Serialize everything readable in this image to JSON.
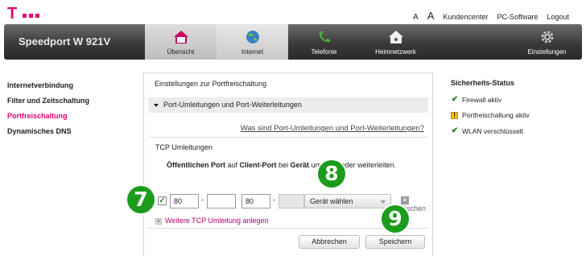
{
  "logo": {
    "letter": "T"
  },
  "toplinks": {
    "a_small": "A",
    "a_big": "A",
    "kundencenter": "Kundencenter",
    "pc_software": "PC-Software",
    "logout": "Logout"
  },
  "navbar": {
    "brand": "Speedport W 921V",
    "tabs": [
      {
        "label": "Übersicht",
        "icon": "house-icon"
      },
      {
        "label": "Internet",
        "icon": "globe-icon"
      },
      {
        "label": "Telefonie",
        "icon": "phone-icon"
      },
      {
        "label": "Heimnetzwerk",
        "icon": "home-network-icon"
      },
      {
        "label": "Einstellungen",
        "icon": "gear-icon"
      }
    ]
  },
  "sidebar": {
    "items": [
      "Internetverbindung",
      "Filter und Zeitschaltung",
      "Portfreischaltung",
      "Dynamisches DNS"
    ]
  },
  "panel": {
    "title": "Einstellungen zur Portfreischaltung",
    "section": "Port-Umleitungen und Port-Weiterleitungen",
    "help_link": "Was sind Port-Umleitungen und Port-Weiterleitungen?",
    "tcp_title": "TCP Umleitungen",
    "desc_1": "Öffentlichen Port",
    "desc_2": " auf ",
    "desc_3": "Client-Port",
    "desc_4": " bei ",
    "desc_5": "Gerät",
    "desc_6": " um",
    "desc_7": " oder weiterleiten.",
    "row": {
      "checked": "✓",
      "port_from": "80",
      "port_to": "",
      "client_from": "80",
      "client_to": "",
      "dash": "-",
      "device": "Gerät wählen",
      "delete": "löschen"
    },
    "add_link": "Weitere TCP Umleitung anlegen",
    "cancel": "Abbrechen",
    "save": "Speichern"
  },
  "status": {
    "title": "Sicherheits-Status",
    "items": [
      {
        "text": "Firewall aktiv",
        "state": "ok"
      },
      {
        "text": "Portfreischaltung aktiv",
        "state": "warn"
      },
      {
        "text": "WLAN verschlüsselt",
        "state": "ok"
      }
    ]
  },
  "badges": {
    "b7": "7",
    "b8": "8",
    "b9": "9"
  },
  "colors": {
    "magenta": "#e20074",
    "badge_green": "#1c9b1c"
  }
}
